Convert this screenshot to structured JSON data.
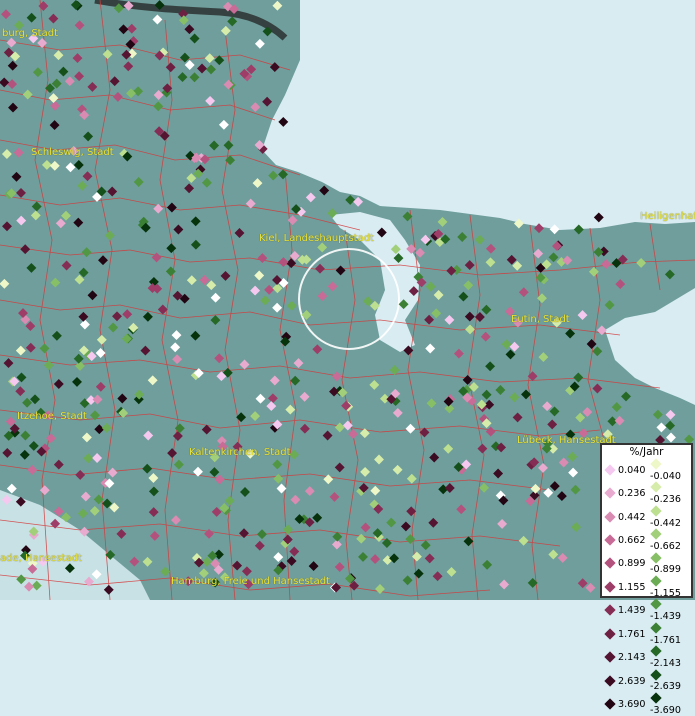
{
  "map": {
    "cities": [
      {
        "id": "hamburg-stadt-nw",
        "label": "burg, Stadt"
      },
      {
        "id": "schleswig",
        "label": "Schleswig, Stadt"
      },
      {
        "id": "kiel",
        "label": "Kiel, Landeshauptstadt"
      },
      {
        "id": "heiligenhafen",
        "label": "Heiligenhafe"
      },
      {
        "id": "eutin",
        "label": "Eutin, Stadt"
      },
      {
        "id": "itzehoe",
        "label": "Itzehoe, Stadt"
      },
      {
        "id": "kaltenkirchen",
        "label": "Kaltenkirchen, Stadt"
      },
      {
        "id": "luebeck",
        "label": "Lübeck, Hansestadt"
      },
      {
        "id": "hansestadt-sw",
        "label": "ade, Hansestadt"
      },
      {
        "id": "hamburg",
        "label": "Hamburg, Freie und Hansestadt"
      }
    ],
    "colors": {
      "sea": "#d8ecf2",
      "land": "#6f9e9c",
      "boundaries": "#d43a3a"
    }
  },
  "legend": {
    "title": "%/Jahr",
    "positive": [
      {
        "label": "0.040",
        "color": "#f5c9ef"
      },
      {
        "label": "0.236",
        "color": "#e8aacf"
      },
      {
        "label": "0.442",
        "color": "#d98bb2"
      },
      {
        "label": "0.662",
        "color": "#c86b96"
      },
      {
        "label": "0.899",
        "color": "#b4527e"
      },
      {
        "label": "1.155",
        "color": "#9e3e68"
      },
      {
        "label": "1.439",
        "color": "#862d55"
      },
      {
        "label": "1.761",
        "color": "#6e2043"
      },
      {
        "label": "2.143",
        "color": "#551532"
      },
      {
        "label": "2.639",
        "color": "#3b0b22"
      },
      {
        "label": "3.690",
        "color": "#220512"
      }
    ],
    "negative": [
      {
        "label": "-0.040",
        "color": "#eef7c8"
      },
      {
        "label": "-0.236",
        "color": "#d6ecaa"
      },
      {
        "label": "-0.442",
        "color": "#bddf90"
      },
      {
        "label": "-0.662",
        "color": "#a2d07a"
      },
      {
        "label": "-0.899",
        "color": "#87bf66"
      },
      {
        "label": "-1.155",
        "color": "#6cac54"
      },
      {
        "label": "-1.439",
        "color": "#529743"
      },
      {
        "label": "-1.761",
        "color": "#3b8034"
      },
      {
        "label": "-2.143",
        "color": "#266826"
      },
      {
        "label": "-2.639",
        "color": "#15501a"
      },
      {
        "label": "-3.690",
        "color": "#06320c"
      }
    ]
  }
}
